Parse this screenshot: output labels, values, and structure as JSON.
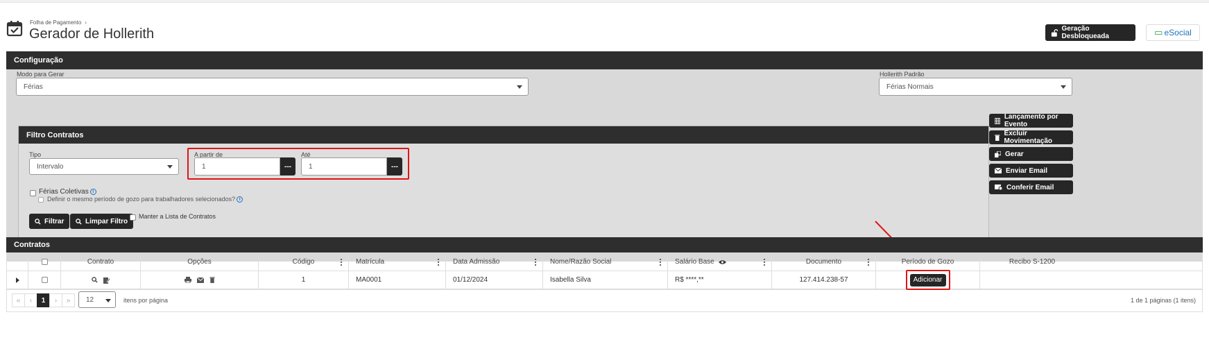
{
  "header": {
    "breadcrumb": "Folha de Pagamento",
    "title": "Gerador de Hollerith",
    "unlock_button": "Geração Desbloqueada",
    "esocial_button": "eSocial"
  },
  "configuracao": {
    "title": "Configuração",
    "modo_label": "Modo para Gerar",
    "modo_value": "Férias",
    "hollerith_label": "Hollerith Padrão",
    "hollerith_value": "Férias Normais"
  },
  "filtro": {
    "title": "Filtro Contratos",
    "tipo_label": "Tipo",
    "tipo_value": "Intervalo",
    "apartir_label": "A partir de",
    "apartir_value": "1",
    "ate_label": "Até",
    "ate_value": "1",
    "dots": "---",
    "ferias_coletivas": "Férias Coletivas",
    "definir_periodo": "Definir o mesmo período de gozo para trabalhadores selecionados?",
    "filtrar_button": "Filtrar",
    "limpar_button": "Limpar Filtro",
    "manter_lista": "Manter a Lista de Contratos"
  },
  "side_actions": {
    "lancamento": "Lançamento por Evento",
    "excluir": "Excluir Movimentação",
    "gerar": "Gerar",
    "enviar_email": "Enviar Email",
    "conferir_email": "Conferir Email"
  },
  "contratos": {
    "title": "Contratos",
    "columns": {
      "contrato": "Contrato",
      "opcoes": "Opções",
      "codigo": "Código",
      "matricula": "Matrícula",
      "admissao": "Data Admissão",
      "nome": "Nome/Razão Social",
      "salario": "Salário Base",
      "documento": "Documento",
      "periodo": "Período de Gozo",
      "recibo": "Recibo S-1200"
    },
    "rows": [
      {
        "codigo": "1",
        "matricula": "MA0001",
        "admissao": "01/12/2024",
        "nome": "Isabella Silva",
        "salario": "R$ ****,**",
        "documento": "127.414.238-57",
        "periodo_button": "Adicionar",
        "recibo": ""
      }
    ]
  },
  "pager": {
    "first": "«",
    "prev": "‹",
    "current_page": "1",
    "next": "›",
    "last": "»",
    "page_size": "12",
    "per_page_label": "itens por página",
    "summary": "1 de 1 páginas (1 itens)"
  },
  "colors": {
    "dark": "#262626",
    "panel_header": "#2e2e2e",
    "panel_bg": "#d9d9d9",
    "highlight": "#e11414",
    "link_blue": "#1b6fc2"
  }
}
